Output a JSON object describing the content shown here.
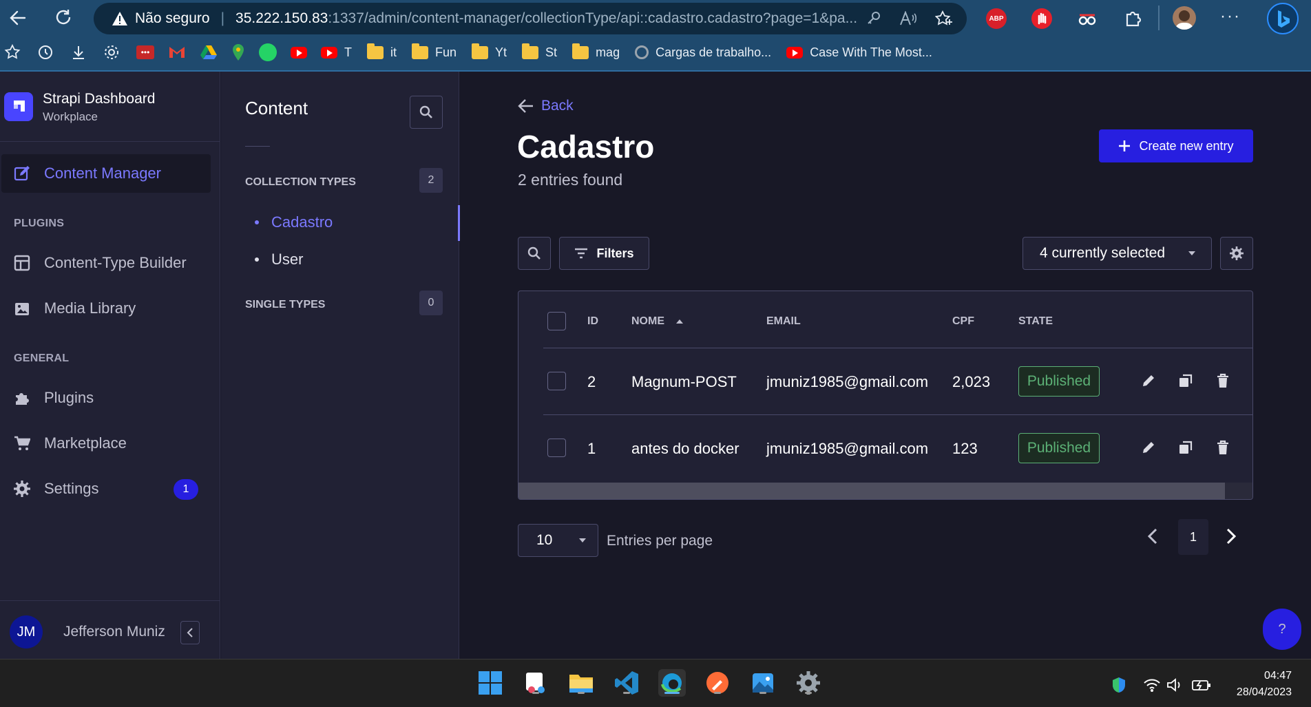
{
  "browser": {
    "security_label": "Não seguro",
    "url_host": "35.222.150.83",
    "url_rest": ":1337/admin/content-manager/collectionType/api::cadastro.cadastro?page=1&pa...",
    "abp_label": "ABP",
    "bookmarks": [
      {
        "icon": "youtube-icon",
        "label": "T"
      },
      {
        "icon": "folder-icon",
        "label": "it"
      },
      {
        "icon": "folder-icon",
        "label": "Fun"
      },
      {
        "icon": "folder-icon",
        "label": "Yt"
      },
      {
        "icon": "folder-icon",
        "label": "St"
      },
      {
        "icon": "folder-icon",
        "label": "mag"
      },
      {
        "icon": "chromium-icon",
        "label": "Cargas de trabalho..."
      },
      {
        "icon": "youtube-icon",
        "label": "Case With The Most..."
      }
    ]
  },
  "sidebar": {
    "brand_title": "Strapi Dashboard",
    "brand_subtitle": "Workplace",
    "active_item": "Content Manager",
    "plugins_heading": "PLUGINS",
    "plugins": [
      "Content-Type Builder",
      "Media Library"
    ],
    "general_heading": "GENERAL",
    "general": [
      "Plugins",
      "Marketplace",
      "Settings"
    ],
    "settings_badge": "1",
    "user_initials": "JM",
    "user_name": "Jefferson Muniz"
  },
  "subnav": {
    "title": "Content",
    "collection_heading": "COLLECTION TYPES",
    "collection_count": "2",
    "collection_items": [
      "Cadastro",
      "User"
    ],
    "single_heading": "SINGLE TYPES",
    "single_count": "0"
  },
  "main": {
    "back_label": "Back",
    "title": "Cadastro",
    "subtitle": "2 entries found",
    "create_label": "Create new entry",
    "filters_label": "Filters",
    "columns_select": "4 currently selected",
    "headers": [
      "ID",
      "NOME",
      "EMAIL",
      "CPF",
      "STATE"
    ],
    "rows": [
      {
        "id": "2",
        "nome": "Magnum-POST",
        "email": "jmuniz1985@gmail.com",
        "cpf": "2,023",
        "state": "Published"
      },
      {
        "id": "1",
        "nome": "antes do docker",
        "email": "jmuniz1985@gmail.com",
        "cpf": "123",
        "state": "Published"
      }
    ],
    "page_size": "10",
    "page_size_label": "Entries per page",
    "current_page": "1",
    "help_label": "?"
  },
  "taskbar": {
    "time": "04:47",
    "date": "28/04/2023"
  },
  "colors": {
    "accent": "#7b79ff",
    "primary_button": "#271fe0",
    "success": "#5cb176",
    "background": "#181826",
    "panel": "#212134"
  }
}
